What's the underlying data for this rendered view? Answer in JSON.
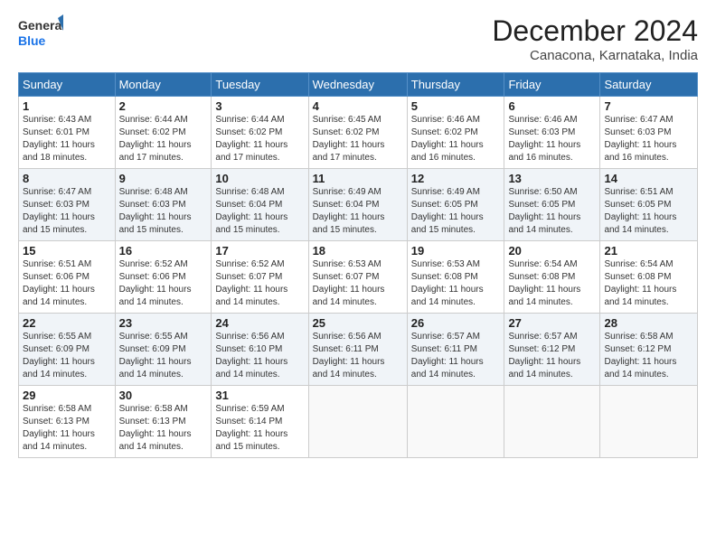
{
  "logo": {
    "line1": "General",
    "line2": "Blue"
  },
  "header": {
    "month": "December 2024",
    "location": "Canacona, Karnataka, India"
  },
  "weekdays": [
    "Sunday",
    "Monday",
    "Tuesday",
    "Wednesday",
    "Thursday",
    "Friday",
    "Saturday"
  ],
  "weeks": [
    [
      {
        "day": "1",
        "info": "Sunrise: 6:43 AM\nSunset: 6:01 PM\nDaylight: 11 hours\nand 18 minutes."
      },
      {
        "day": "2",
        "info": "Sunrise: 6:44 AM\nSunset: 6:02 PM\nDaylight: 11 hours\nand 17 minutes."
      },
      {
        "day": "3",
        "info": "Sunrise: 6:44 AM\nSunset: 6:02 PM\nDaylight: 11 hours\nand 17 minutes."
      },
      {
        "day": "4",
        "info": "Sunrise: 6:45 AM\nSunset: 6:02 PM\nDaylight: 11 hours\nand 17 minutes."
      },
      {
        "day": "5",
        "info": "Sunrise: 6:46 AM\nSunset: 6:02 PM\nDaylight: 11 hours\nand 16 minutes."
      },
      {
        "day": "6",
        "info": "Sunrise: 6:46 AM\nSunset: 6:03 PM\nDaylight: 11 hours\nand 16 minutes."
      },
      {
        "day": "7",
        "info": "Sunrise: 6:47 AM\nSunset: 6:03 PM\nDaylight: 11 hours\nand 16 minutes."
      }
    ],
    [
      {
        "day": "8",
        "info": "Sunrise: 6:47 AM\nSunset: 6:03 PM\nDaylight: 11 hours\nand 15 minutes."
      },
      {
        "day": "9",
        "info": "Sunrise: 6:48 AM\nSunset: 6:03 PM\nDaylight: 11 hours\nand 15 minutes."
      },
      {
        "day": "10",
        "info": "Sunrise: 6:48 AM\nSunset: 6:04 PM\nDaylight: 11 hours\nand 15 minutes."
      },
      {
        "day": "11",
        "info": "Sunrise: 6:49 AM\nSunset: 6:04 PM\nDaylight: 11 hours\nand 15 minutes."
      },
      {
        "day": "12",
        "info": "Sunrise: 6:49 AM\nSunset: 6:05 PM\nDaylight: 11 hours\nand 15 minutes."
      },
      {
        "day": "13",
        "info": "Sunrise: 6:50 AM\nSunset: 6:05 PM\nDaylight: 11 hours\nand 14 minutes."
      },
      {
        "day": "14",
        "info": "Sunrise: 6:51 AM\nSunset: 6:05 PM\nDaylight: 11 hours\nand 14 minutes."
      }
    ],
    [
      {
        "day": "15",
        "info": "Sunrise: 6:51 AM\nSunset: 6:06 PM\nDaylight: 11 hours\nand 14 minutes."
      },
      {
        "day": "16",
        "info": "Sunrise: 6:52 AM\nSunset: 6:06 PM\nDaylight: 11 hours\nand 14 minutes."
      },
      {
        "day": "17",
        "info": "Sunrise: 6:52 AM\nSunset: 6:07 PM\nDaylight: 11 hours\nand 14 minutes."
      },
      {
        "day": "18",
        "info": "Sunrise: 6:53 AM\nSunset: 6:07 PM\nDaylight: 11 hours\nand 14 minutes."
      },
      {
        "day": "19",
        "info": "Sunrise: 6:53 AM\nSunset: 6:08 PM\nDaylight: 11 hours\nand 14 minutes."
      },
      {
        "day": "20",
        "info": "Sunrise: 6:54 AM\nSunset: 6:08 PM\nDaylight: 11 hours\nand 14 minutes."
      },
      {
        "day": "21",
        "info": "Sunrise: 6:54 AM\nSunset: 6:08 PM\nDaylight: 11 hours\nand 14 minutes."
      }
    ],
    [
      {
        "day": "22",
        "info": "Sunrise: 6:55 AM\nSunset: 6:09 PM\nDaylight: 11 hours\nand 14 minutes."
      },
      {
        "day": "23",
        "info": "Sunrise: 6:55 AM\nSunset: 6:09 PM\nDaylight: 11 hours\nand 14 minutes."
      },
      {
        "day": "24",
        "info": "Sunrise: 6:56 AM\nSunset: 6:10 PM\nDaylight: 11 hours\nand 14 minutes."
      },
      {
        "day": "25",
        "info": "Sunrise: 6:56 AM\nSunset: 6:11 PM\nDaylight: 11 hours\nand 14 minutes."
      },
      {
        "day": "26",
        "info": "Sunrise: 6:57 AM\nSunset: 6:11 PM\nDaylight: 11 hours\nand 14 minutes."
      },
      {
        "day": "27",
        "info": "Sunrise: 6:57 AM\nSunset: 6:12 PM\nDaylight: 11 hours\nand 14 minutes."
      },
      {
        "day": "28",
        "info": "Sunrise: 6:58 AM\nSunset: 6:12 PM\nDaylight: 11 hours\nand 14 minutes."
      }
    ],
    [
      {
        "day": "29",
        "info": "Sunrise: 6:58 AM\nSunset: 6:13 PM\nDaylight: 11 hours\nand 14 minutes."
      },
      {
        "day": "30",
        "info": "Sunrise: 6:58 AM\nSunset: 6:13 PM\nDaylight: 11 hours\nand 14 minutes."
      },
      {
        "day": "31",
        "info": "Sunrise: 6:59 AM\nSunset: 6:14 PM\nDaylight: 11 hours\nand 15 minutes."
      },
      {
        "day": "",
        "info": ""
      },
      {
        "day": "",
        "info": ""
      },
      {
        "day": "",
        "info": ""
      },
      {
        "day": "",
        "info": ""
      }
    ]
  ]
}
